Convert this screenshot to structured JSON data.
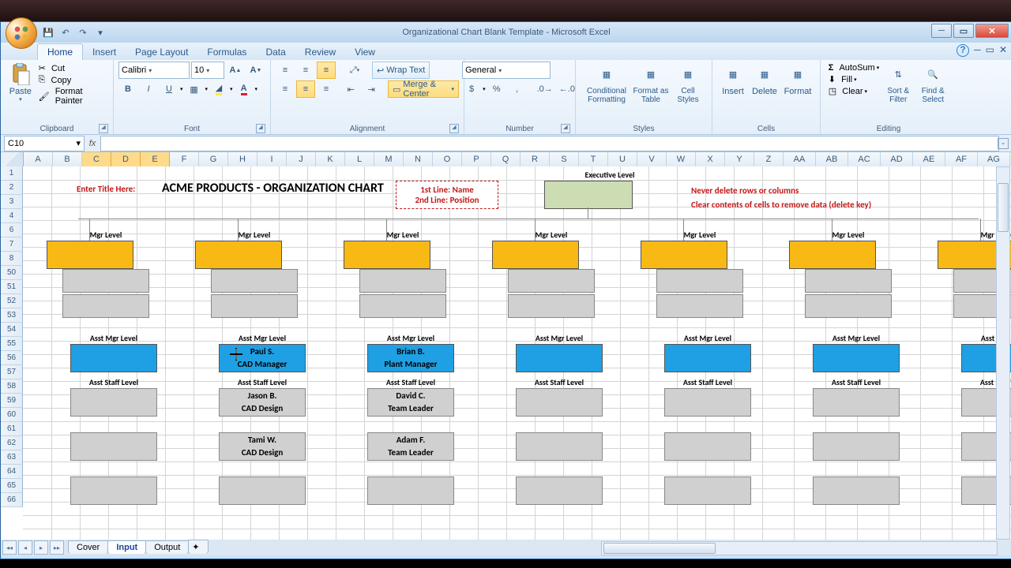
{
  "window": {
    "title": "Organizational Chart Blank Template - Microsoft Excel"
  },
  "qat": {
    "save": "💾",
    "undo": "↶",
    "redo": "↷",
    "custom": "▾"
  },
  "tabs": [
    "Home",
    "Insert",
    "Page Layout",
    "Formulas",
    "Data",
    "Review",
    "View"
  ],
  "ribbon": {
    "clipboard": {
      "label": "Clipboard",
      "paste": "Paste",
      "cut": "Cut",
      "copy": "Copy",
      "fpainter": "Format Painter"
    },
    "font": {
      "label": "Font",
      "name": "Calibri",
      "size": "10",
      "bold": "B",
      "italic": "I",
      "underline": "U"
    },
    "alignment": {
      "label": "Alignment",
      "wrap": "Wrap Text",
      "merge": "Merge & Center"
    },
    "number": {
      "label": "Number",
      "format": "General",
      "currency": "$",
      "percent": "%",
      "comma": ","
    },
    "styles": {
      "label": "Styles",
      "cond": "Conditional Formatting",
      "table": "Format as Table",
      "cell": "Cell Styles"
    },
    "cells": {
      "label": "Cells",
      "insert": "Insert",
      "delete": "Delete",
      "format": "Format"
    },
    "editing": {
      "label": "Editing",
      "sum": "AutoSum",
      "fill": "Fill",
      "clear": "Clear",
      "sort": "Sort & Filter",
      "find": "Find & Select"
    }
  },
  "namebox": "C10",
  "columns": [
    "A",
    "B",
    "C",
    "D",
    "E",
    "F",
    "G",
    "H",
    "I",
    "J",
    "K",
    "L",
    "M",
    "N",
    "O",
    "P",
    "Q",
    "R",
    "S",
    "T",
    "U",
    "V",
    "W",
    "X",
    "Y",
    "Z",
    "AA",
    "AB",
    "AC",
    "AD",
    "AE",
    "AF",
    "AG"
  ],
  "selected_cols": [
    "C",
    "D",
    "E"
  ],
  "rows": [
    "1",
    "2",
    "3",
    "4",
    "6",
    "7",
    "8",
    "50",
    "51",
    "52",
    "53",
    "54",
    "55",
    "56",
    "57",
    "58",
    "59",
    "60",
    "61",
    "62",
    "63",
    "64",
    "65",
    "66"
  ],
  "content": {
    "enter_title": "Enter Title Here:",
    "title": "ACME PRODUCTS - ORGANIZATION CHART",
    "legend1": "1st Line: Name",
    "legend2": "2nd Line: Position",
    "exec_label": "Executive Level",
    "warn1": "Never delete rows or columns",
    "warn2": "Clear contents of cells to remove data (delete key)",
    "mgr_label": "Mgr Level",
    "asstmgr_label": "Asst Mgr Level",
    "asststaff_label": "Asst Staff Level",
    "paul_name": "Paul S.",
    "paul_pos": "CAD Manager",
    "brian_name": "Brian B.",
    "brian_pos": "Plant Manager",
    "jason_name": "Jason B.",
    "jason_pos": "CAD Design",
    "tami_name": "Tami W.",
    "tami_pos": "CAD Design",
    "david_name": "David C.",
    "david_pos": "Team Leader",
    "adam_name": "Adam F.",
    "adam_pos": "Team Leader"
  },
  "sheets": {
    "nav": [
      "◂◂",
      "◂",
      "▸",
      "▸▸"
    ],
    "tabs": [
      "Cover",
      "Input",
      "Output"
    ],
    "active": "Input"
  }
}
